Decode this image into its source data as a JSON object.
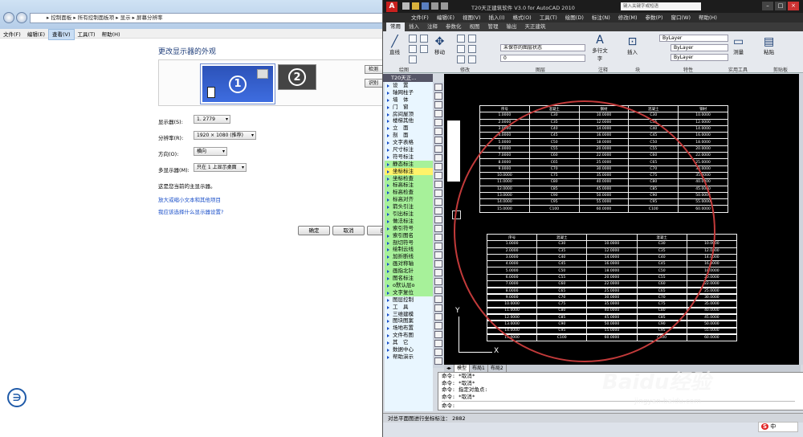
{
  "control_panel": {
    "breadcrumb": "▸ 控制面板 ▸ 所有控制面板项 ▸ 显示 ▸ 屏幕分辨率",
    "menu": [
      "文件(F)",
      "编辑(E)",
      "查看(V)",
      "工具(T)",
      "帮助(H)"
    ],
    "heading": "更改显示器的外观",
    "monitor1": "1",
    "monitor2": "2",
    "detect_button": "检测",
    "identify_button": "识别",
    "display_label": "显示器(S):",
    "display_value": "1. 2779",
    "resolution_label": "分辨率(R):",
    "resolution_value": "1920 × 1080 (推荐)",
    "orientation_label": "方向(O):",
    "orientation_value": "横向",
    "multi_label": "多显示器(M):",
    "multi_value": "只在 1 上显示桌面",
    "primary_note": "这是您当前的主显示器。",
    "link_text_size": "放大或缩小文本和其他项目",
    "link_which_settings": "我应该选择什么显示器设置?",
    "ok_button": "确定",
    "cancel_button": "取消",
    "apply_button": "应"
  },
  "autocad": {
    "title": "T20天正建筑软件 V3.0 for AutoCAD 2010",
    "search_placeholder": "键入关键字或短语",
    "menu": [
      "文件(F)",
      "编辑(E)",
      "视图(V)",
      "插入(I)",
      "格式(O)",
      "工具(T)",
      "绘图(D)",
      "标注(N)",
      "修改(M)",
      "参数(P)",
      "窗口(W)",
      "帮助(H)"
    ],
    "ribbon_tabs": [
      "常用",
      "插入",
      "注释",
      "参数化",
      "视图",
      "管理",
      "输出",
      "天正建筑"
    ],
    "ribbon_panels": [
      "绘图",
      "修改",
      "图层",
      "注释",
      "块",
      "特性",
      "实用工具",
      "剪贴板"
    ],
    "ribbon_labels": {
      "line": "直线",
      "move": "移动",
      "layer_state": "未保存的图层状态",
      "layer_current": "0",
      "multiline_text": "多行文字",
      "insert": "插入",
      "bylayer": "ByLayer",
      "measure": "测量",
      "paste": "粘贴"
    },
    "t20_header": "T20天正...",
    "t20_menu": [
      {
        "label": "设　置",
        "style": ""
      },
      {
        "label": "轴网柱子",
        "style": ""
      },
      {
        "label": "墙　体",
        "style": ""
      },
      {
        "label": "门　窗",
        "style": ""
      },
      {
        "label": "房间屋顶",
        "style": ""
      },
      {
        "label": "楼梯其他",
        "style": ""
      },
      {
        "label": "立　面",
        "style": ""
      },
      {
        "label": "剖　面",
        "style": ""
      },
      {
        "label": "文字表格",
        "style": ""
      },
      {
        "label": "尺寸标注",
        "style": ""
      },
      {
        "label": "符号标注",
        "style": ""
      },
      {
        "label": "静态标注",
        "style": "green"
      },
      {
        "label": "坐标标注",
        "style": "sel"
      },
      {
        "label": "坐标检查",
        "style": "green"
      },
      {
        "label": "标高标注",
        "style": "green"
      },
      {
        "label": "标高检查",
        "style": "green"
      },
      {
        "label": "标高对齐",
        "style": "green"
      },
      {
        "label": "箭头引注",
        "style": "green"
      },
      {
        "label": "引出标注",
        "style": "green"
      },
      {
        "label": "做法标注",
        "style": "green"
      },
      {
        "label": "索引符号",
        "style": "green"
      },
      {
        "label": "索引图名",
        "style": "green"
      },
      {
        "label": "剖切符号",
        "style": "green"
      },
      {
        "label": "绘制云线",
        "style": "green"
      },
      {
        "label": "加折断线",
        "style": "green"
      },
      {
        "label": "画对称轴",
        "style": "green"
      },
      {
        "label": "画指北针",
        "style": "green"
      },
      {
        "label": "图名标注",
        "style": "green"
      },
      {
        "label": "o默认层o",
        "style": "green"
      },
      {
        "label": "文字复位",
        "style": "green"
      },
      {
        "label": "图层控制",
        "style": ""
      },
      {
        "label": "工　具",
        "style": ""
      },
      {
        "label": "三维建模",
        "style": ""
      },
      {
        "label": "图块图案",
        "style": ""
      },
      {
        "label": "场地布置",
        "style": ""
      },
      {
        "label": "文件布图",
        "style": ""
      },
      {
        "label": "其　它",
        "style": ""
      },
      {
        "label": "数据中心",
        "style": ""
      },
      {
        "label": "帮助演示",
        "style": ""
      }
    ],
    "layout_tabs": [
      "模型",
      "布局1",
      "布局2"
    ],
    "commands": [
      "命令: *取消*",
      "命令: *取消*",
      "命令: 指定对角点:",
      "命令: *取消*"
    ],
    "command_prompt": "命令:",
    "status_text": "对总平面图进行坐标标注： 2882",
    "ucs_x": "X",
    "ucs_y": "Y"
  },
  "table1": {
    "headers": [
      "序号",
      "混凝土",
      "钢材",
      "混凝土",
      "钢材"
    ],
    "rows": [
      [
        "1.0000",
        "C30",
        "10.0000",
        "C30",
        "10.0000"
      ],
      [
        "2.0000",
        "C35",
        "12.0000",
        "C35",
        "12.0000"
      ],
      [
        "3.0000",
        "C40",
        "14.0000",
        "C40",
        "14.0000"
      ],
      [
        "4.0000",
        "C45",
        "16.0000",
        "C45",
        "16.0000"
      ],
      [
        "5.0000",
        "C50",
        "18.0000",
        "C50",
        "18.0000"
      ],
      [
        "6.0000",
        "C55",
        "20.0000",
        "C55",
        "20.0000"
      ],
      [
        "7.0000",
        "C60",
        "22.0000",
        "C60",
        "22.0000"
      ],
      [
        "8.0000",
        "C65",
        "25.0000",
        "C65",
        "25.0000"
      ],
      [
        "9.0000",
        "C70",
        "30.0000",
        "C70",
        "30.0000"
      ],
      [
        "10.0000",
        "C75",
        "35.0000",
        "C75",
        "35.0000"
      ],
      [
        "11.0000",
        "C80",
        "40.0000",
        "C80",
        "40.0000"
      ],
      [
        "12.0000",
        "C85",
        "45.0000",
        "C85",
        "45.0000"
      ],
      [
        "13.0000",
        "C90",
        "50.0000",
        "C90",
        "50.0000"
      ],
      [
        "14.0000",
        "C95",
        "55.0000",
        "C95",
        "55.0000"
      ],
      [
        "15.0000",
        "C100",
        "60.0000",
        "C100",
        "60.0000"
      ]
    ]
  },
  "table2": {
    "headers": [
      "序号",
      "",
      "混凝土",
      "",
      "混凝土",
      ""
    ],
    "rows": [
      [
        "1.0000",
        "C30",
        "10.0000",
        "C30",
        "10.0000"
      ],
      [
        "2.0000",
        "C35",
        "12.0000",
        "C35",
        "12.0000"
      ],
      [
        "3.0000",
        "C40",
        "14.0000",
        "C40",
        "14.0000"
      ],
      [
        "4.0000",
        "C45",
        "16.0000",
        "C45",
        "16.0000"
      ],
      [
        "5.0000",
        "C50",
        "18.0000",
        "C50",
        "18.0000"
      ],
      [
        "6.0000",
        "C55",
        "20.0000",
        "C55",
        "20.0000"
      ],
      [
        "7.0000",
        "C60",
        "22.0000",
        "C60",
        "22.0000"
      ],
      [
        "8.0000",
        "C65",
        "25.0000",
        "C65",
        "25.0000"
      ],
      [
        "9.0000",
        "C70",
        "30.0000",
        "C70",
        "30.0000"
      ],
      [
        "10.0000",
        "C75",
        "35.0000",
        "C75",
        "35.0000"
      ],
      [
        "11.0000",
        "C80",
        "40.0000",
        "C80",
        "40.0000"
      ],
      [
        "12.0000",
        "C85",
        "45.0000",
        "C85",
        "45.0000"
      ],
      [
        "13.0000",
        "C90",
        "50.0000",
        "C90",
        "50.0000"
      ],
      [
        "14.0000",
        "C95",
        "55.0000",
        "C95",
        "55.0000"
      ],
      [
        "15.0000",
        "C100",
        "60.0000",
        "C100",
        "60.0000"
      ]
    ]
  },
  "watermark": {
    "brand": "Baidu经验",
    "url": "jingyan.baidu.com"
  },
  "ime": {
    "badge": "S",
    "label": "中"
  }
}
